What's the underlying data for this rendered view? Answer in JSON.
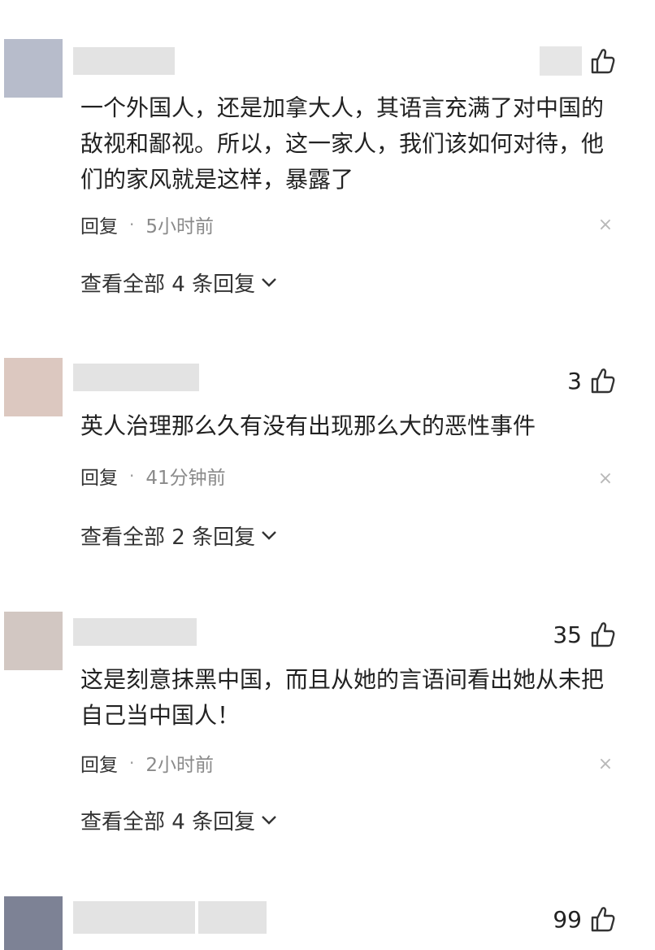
{
  "comments": [
    {
      "text_lines": [
        "一个外国人，还是加拿大人，其语言充满了对中国的",
        "敌视和鄙视。所以，这一家人，我们该如何对待，他",
        "们的家风就是这样，暴露了"
      ],
      "likes": "",
      "reply_label": "回复",
      "dot": "·",
      "time": "5小时前",
      "dismiss": "×",
      "view_all": "查看全部 4 条回复",
      "avatar_color": "#b7bccb"
    },
    {
      "text_lines": [
        "英人治理那么久有没有出现那么大的恶性事件"
      ],
      "likes": "3",
      "reply_label": "回复",
      "dot": "·",
      "time": "41分钟前",
      "dismiss": "×",
      "view_all": "查看全部 2 条回复",
      "avatar_color": "#dcc8c0"
    },
    {
      "text_lines": [
        "这是刻意抹黑中国，而且从她的言语间看出她从未把",
        "自己当中国人！"
      ],
      "likes": "35",
      "reply_label": "回复",
      "dot": "·",
      "time": "2小时前",
      "dismiss": "×",
      "view_all": "查看全部 4 条回复",
      "avatar_color": "#d2c7c2"
    },
    {
      "text_lines": [],
      "likes": "99",
      "avatar_color": "#7d8295"
    }
  ]
}
